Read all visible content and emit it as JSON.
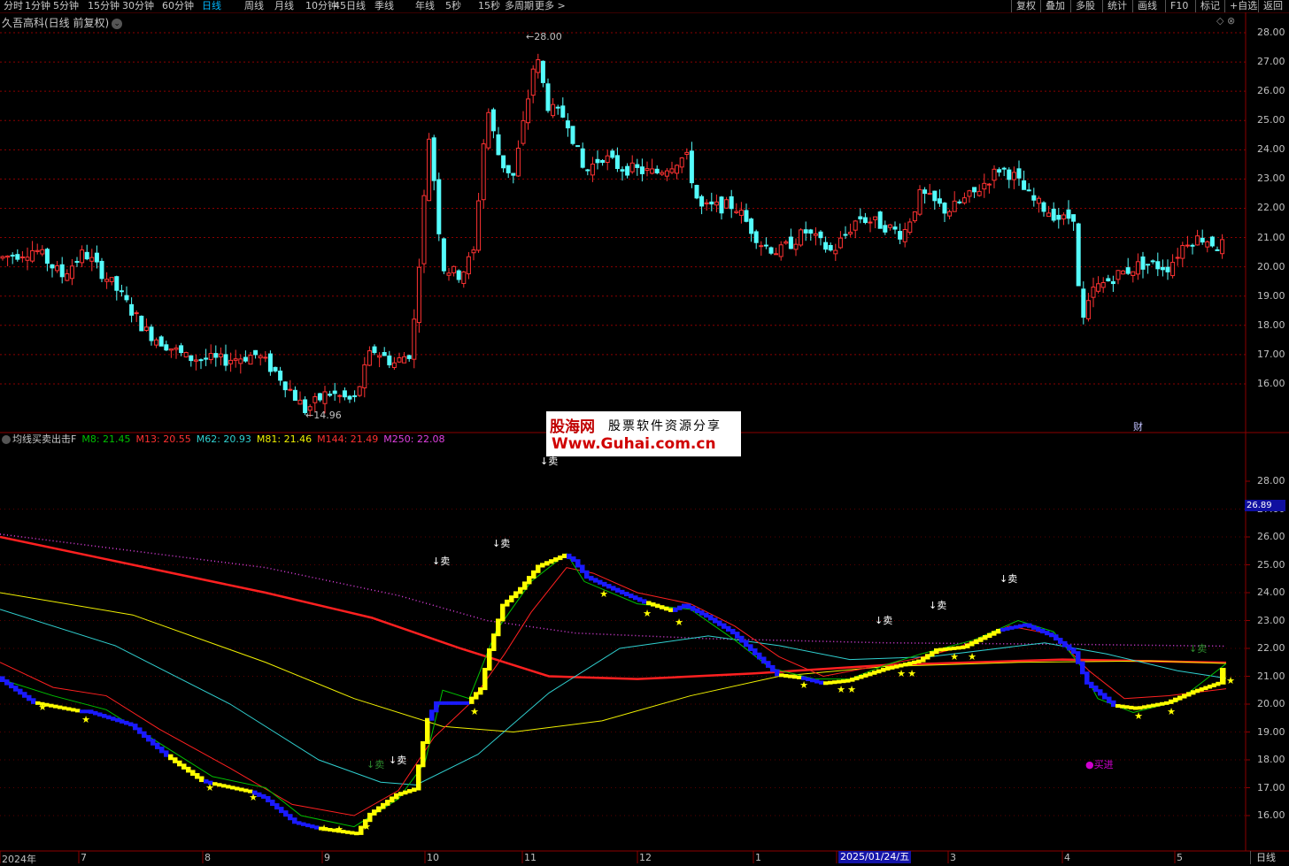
{
  "top_menu": {
    "items": [
      "分时",
      "1分钟",
      "5分钟",
      "15分钟",
      "30分钟",
      "60分钟",
      "日线",
      "周线",
      "月线",
      "10分钟",
      "45日线",
      "季线",
      "年线",
      "5秒",
      "15秒",
      "多周期",
      "更多 >"
    ],
    "active": "日线",
    "right_buttons": [
      "复权",
      "叠加",
      "多股",
      "统计",
      "画线",
      "F10",
      "标记",
      "+自选",
      "返回"
    ]
  },
  "stock": {
    "title": "久吾高科(日线 前复权)",
    "high_marker": "28.00",
    "low_marker": "14.96",
    "finance_label": "财"
  },
  "price_axis": {
    "ticks": [
      "28.00",
      "27.00",
      "26.00",
      "25.00",
      "24.00",
      "23.00",
      "22.00",
      "21.00",
      "20.00",
      "19.00",
      "18.00",
      "17.00",
      "16.00"
    ]
  },
  "indicator": {
    "name": "均线买卖出击F",
    "values": [
      {
        "label": "M8: 21.45",
        "color": "#00c000"
      },
      {
        "label": "M13: 20.55",
        "color": "#ff3030"
      },
      {
        "label": "M62: 20.93",
        "color": "#30d0d0"
      },
      {
        "label": "M81: 21.46",
        "color": "#f0f000"
      },
      {
        "label": "M144: 21.49",
        "color": "#ff3030"
      },
      {
        "label": "M250: 22.08",
        "color": "#e040e0"
      }
    ],
    "axis_ticks": [
      "28.00",
      "27.00",
      "26.00",
      "25.00",
      "24.00",
      "23.00",
      "22.00",
      "21.00",
      "20.00",
      "19.00",
      "18.00",
      "17.00",
      "16.00"
    ],
    "current_price": "26.89",
    "signals": {
      "sell": "↓卖",
      "buy": "●买进"
    }
  },
  "watermark": {
    "brand": "股海网",
    "tagline": "股票软件资源分享",
    "url": "Www.Guhai.com.cn"
  },
  "date_axis": {
    "labels": [
      "2024年",
      "7",
      "8",
      "9",
      "10",
      "11",
      "12",
      "1",
      "2025/01/24/五",
      "3",
      "4",
      "5"
    ],
    "period_button": "日线"
  },
  "colors": {
    "up": "#ff3232",
    "down": "#54fcfc",
    "grid": "#8b0000",
    "m8": "#00c000",
    "m13": "#ff2020",
    "m62": "#30d0d0",
    "m81": "#f0f000",
    "m144": "#ff2020",
    "m250": "#e040e0",
    "stair_up": "#ffff00",
    "stair_down": "#1a1aff",
    "star": "#ffff00"
  }
}
